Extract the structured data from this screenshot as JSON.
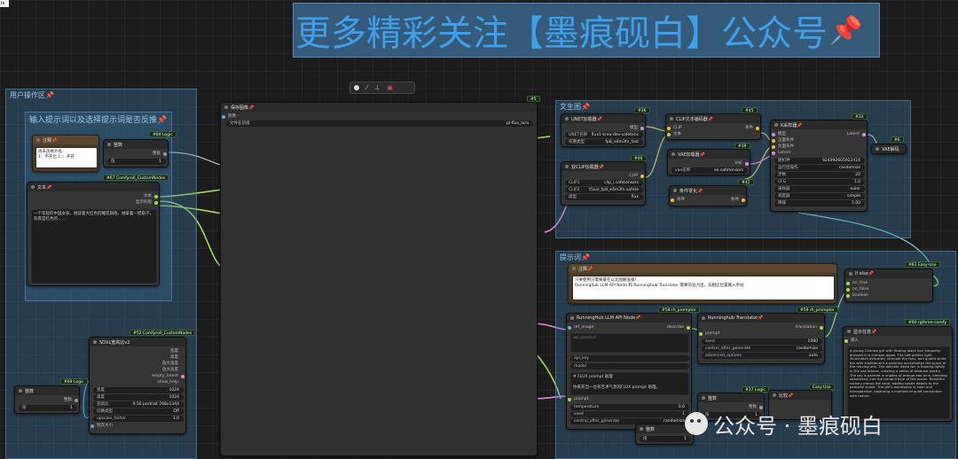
{
  "file_tab": "le",
  "banner": {
    "text": "更多精彩关注【墨痕砚白】公众号",
    "pin": "📌"
  },
  "toolbar": {
    "items": [
      "color-dot-icon",
      "wand-icon",
      "pin-icon",
      "trash-icon"
    ]
  },
  "groups": {
    "user_area": "用户操作区📌",
    "prompt_input": "输入提示词以及选择提示词是否反推📌",
    "text2img": "文生图📌",
    "prompt_word": "提示词📌"
  },
  "nodes": {
    "note1": {
      "title": "注释📌",
      "content": "尚未风格外名：\n1：不开启 2：：开开"
    },
    "text_node": {
      "title": "文本📌",
      "content": "一个年轻的中国女孩，她穿着大红色的雕花旗袍，她拿着一把扇子，背景是红色的……"
    },
    "int_node1": {
      "title": "整数",
      "out": "整数",
      "badge": "#84 Logic",
      "widget_label": "值",
      "widget_value": "1"
    },
    "custom_node_badge": "#67 ComfyroII_CustomNodes",
    "text_outputs": [
      "文本",
      "显示的版"
    ],
    "sdxl": {
      "title": "SDXL宽高比v2",
      "badge": "#52 ComfyroII_CustomNodes",
      "outputs": [
        "宽度",
        "高度",
        "放大宽度",
        "放大高度",
        "empty_latent",
        "show_help"
      ],
      "widgets": [
        {
          "label": "宽度",
          "value": "1024"
        },
        {
          "label": "高度",
          "value": "1024"
        },
        {
          "label": "宽高比",
          "value": "9:16 portrait 768x1344"
        },
        {
          "label": "切换类型",
          "value": "Off"
        },
        {
          "label": "upscale_factor",
          "value": "1.0"
        }
      ],
      "input": "批次大小"
    },
    "int_node2": {
      "title": "整数",
      "out": "整数",
      "badge": "#69 Logic",
      "widget_label": "值",
      "widget_value": "1"
    },
    "save_image": {
      "title": "保存图像📌",
      "input": "图像",
      "widget_label": "文件名前缀",
      "widget_value": "pl-flux_lora",
      "badge": "#5"
    },
    "unet": {
      "title": "UNET加载器📌",
      "badge": "#36",
      "out": "模型",
      "widgets": [
        {
          "label": "UNET名称",
          "value": "flux1-krea-dev-safetens"
        },
        {
          "label": "权重类型",
          "value": "fp8_e4m3fn_fast"
        }
      ]
    },
    "dualclip": {
      "title": "双CLIP加载器📌",
      "badge": "#46",
      "out": "CLIP",
      "widgets": [
        {
          "label": "CLIP1",
          "value": "clip_l.safetensors"
        },
        {
          "label": "CLIP2",
          "value": "t5xxl_fp8_e4m3fn.safete"
        },
        {
          "label": "类型",
          "value": "flux"
        }
      ]
    },
    "clip_encode": {
      "title": "CLIP文本编码器📌",
      "badge": "#45",
      "in1": "CLIP",
      "in2": "文本",
      "out": "条件"
    },
    "vae_loader": {
      "title": "VAE加载器📌",
      "badge": "#39",
      "out": "VAE",
      "widget_label": "vae名称",
      "widget_value": "ae.safetensors"
    },
    "cond_zero": {
      "title": "条件零化📌",
      "badge": "#42",
      "in": "条件",
      "out": "条件"
    },
    "ksampler": {
      "title": "K采样器📌",
      "badge": "#33",
      "inputs": [
        "模型",
        "正面条件",
        "负面条件",
        "Latent"
      ],
      "out": "Latent",
      "widgets": [
        {
          "label": "随机种",
          "value": "924092605922416"
        },
        {
          "label": "运行后操作",
          "value": "randomize"
        },
        {
          "label": "步数",
          "value": "20"
        },
        {
          "label": "CFG",
          "value": "1.0"
        },
        {
          "label": "采样器",
          "value": "euler"
        },
        {
          "label": "调度器",
          "value": "simple"
        },
        {
          "label": "降噪",
          "value": "1.00"
        }
      ]
    },
    "vae_decode": {
      "title": "VAE解码",
      "badge": "#6"
    },
    "note2": {
      "title": "注释📌",
      "content": "只要使用只需要最在以北图解准备！\nRunninghub LLM API Node 和 Runninghub Translator 需要的准力出，去相应位置输入手动"
    },
    "ifelse": {
      "title": "if else📌",
      "badge": "#61 Easy-Use",
      "inputs": [
        "on_true",
        "on_false",
        "boolean"
      ]
    },
    "show_text": {
      "title": "显示任意📌",
      "badge": "#60 rgthree-comfy",
      "in": "输入",
      "content": "A young Chinese girl with flowing black hair elegantly dressed in a crimson qipao. The soft golden light illuminates delicately intricate the fans, and quaint white fan with traditional ink painting accentuates the grace of the moving one. The delicate white fan is floating lightly in the sea breeze, creating a sense of ethereal poetry. The sky is painted in shades of orange and pink, blending seamlessly into the tranquil blue of the ocean. Beautiful rockery pieces the sand, adding subtle details to the peaceful scene. The girl's expression is calm and introspective, capturing a moment of quiet connection with nature."
    },
    "llm": {
      "title": "RunningHub LLM API Node📌",
      "badge": "#58 rh_prompter",
      "in": "ref_image",
      "out": "describe",
      "placeholder": "api_baseurl",
      "w1": "api_key",
      "w2": "model",
      "prompt_label": "prompt",
      "text": "# FLUX prompt 助理\n\n你来充当一位有艺术气息的FLUX prompt 助理。",
      "widgets": [
        {
          "label": "temperature",
          "value": "0.6"
        },
        {
          "label": "seed",
          "value": "1"
        },
        {
          "label": "control_after_generate",
          "value": "randomize"
        }
      ]
    },
    "translator": {
      "title": "Runninghub Translator📌",
      "badge": "#59 rh_prompter",
      "in": "prompt",
      "out": "translation",
      "widgets": [
        {
          "label": "seed",
          "value": "1080"
        },
        {
          "label": "control_after_generate",
          "value": "randomize"
        },
        {
          "label": "advanced_options",
          "value": "auto"
        }
      ]
    },
    "int_node3": {
      "title": "整数",
      "badge": "#37 Logic",
      "out": "整数",
      "widget_label": "值",
      "widget_value": "1"
    },
    "compare": {
      "title": "比较📌",
      "badge": "Easy-Use"
    },
    "small_int": {
      "title": "整数",
      "widget_label": "值",
      "widget_value": "1"
    }
  },
  "watermark": "公众号 · 墨痕砚白",
  "colors": {
    "group": "#3f7fae",
    "node": "#353535",
    "link_green": "#a8d84b",
    "link_pink": "#e58ad6",
    "link_yellow": "#e0c23c",
    "link_blue": "#5aa2e0"
  }
}
